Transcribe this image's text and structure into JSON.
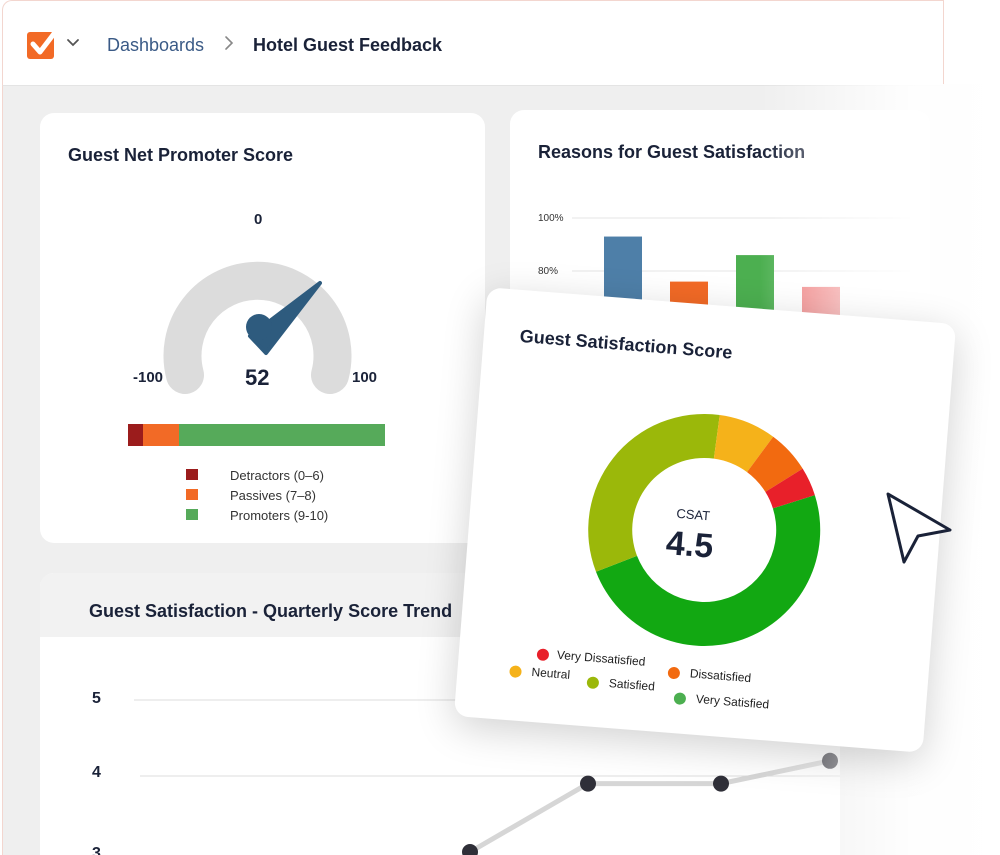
{
  "breadcrumb": {
    "root": "Dashboards",
    "current": "Hotel Guest Feedback"
  },
  "colors": {
    "accent": "#f26a26",
    "navy": "#1a2238",
    "link": "#3a5a86"
  },
  "nps_card": {
    "title": "Guest Net Promoter Score",
    "gauge": {
      "min_label": "-100",
      "max_label": "100",
      "top_label": "0",
      "value_label": "52",
      "value": 52,
      "min": -100,
      "max": 100
    },
    "distribution": {
      "detractors": 6,
      "passives": 14,
      "promoters": 80
    },
    "legend": [
      {
        "label": "Detractors (0–6)",
        "color": "#9b1c1c"
      },
      {
        "label": "Passives (7–8)",
        "color": "#f26a26"
      },
      {
        "label": "Promoters (9-10)",
        "color": "#56aa5a"
      }
    ]
  },
  "reasons_card": {
    "title": "Reasons for Guest Satisfaction",
    "chart_data": {
      "type": "bar",
      "y_ticks": [
        "100%",
        "80%"
      ],
      "ylim": [
        0,
        100
      ],
      "values": [
        93,
        76,
        86,
        74
      ],
      "colors": [
        "#4e7fa8",
        "#f26a26",
        "#4caf50",
        "#f08080"
      ]
    }
  },
  "trend_card": {
    "title": "Guest Satisfaction - Quarterly Score Trend",
    "chart_data": {
      "type": "line",
      "y_ticks": [
        "5",
        "4",
        "3"
      ],
      "points": [
        {
          "x": 0,
          "y": 3.0
        },
        {
          "x": 1,
          "y": 3.9
        },
        {
          "x": 2,
          "y": 3.9
        },
        {
          "x": 3,
          "y": 4.2
        }
      ]
    }
  },
  "csat_card": {
    "title": "Guest Satisfaction Score",
    "center_label": "CSAT",
    "center_value": "4.5",
    "chart_data": {
      "type": "pie",
      "slices": [
        {
          "label": "Very Dissatisfied",
          "value": 4,
          "color": "#e8202a"
        },
        {
          "label": "Dissatisfied",
          "value": 6,
          "color": "#f26a10"
        },
        {
          "label": "Neutral",
          "value": 8,
          "color": "#f5b21a"
        },
        {
          "label": "Satisfied",
          "value": 33,
          "color": "#9bb80a"
        },
        {
          "label": "Very Satisfied",
          "value": 49,
          "color": "#12a812"
        }
      ]
    },
    "legend": [
      {
        "label": "Very Dissatisfied",
        "color": "#e8202a"
      },
      {
        "label": "Neutral",
        "color": "#f5b21a"
      },
      {
        "label": "Satisfied",
        "color": "#9bb80a"
      },
      {
        "label": "Dissatisfied",
        "color": "#f26a10"
      },
      {
        "label": "Very Satisfied",
        "color": "#4caf50"
      }
    ]
  },
  "icons": {
    "logo": "checkbox-logo-icon",
    "dropdown": "chevron-down-icon",
    "separator": "chevron-right-icon",
    "cursor": "pointer-cursor-icon"
  }
}
